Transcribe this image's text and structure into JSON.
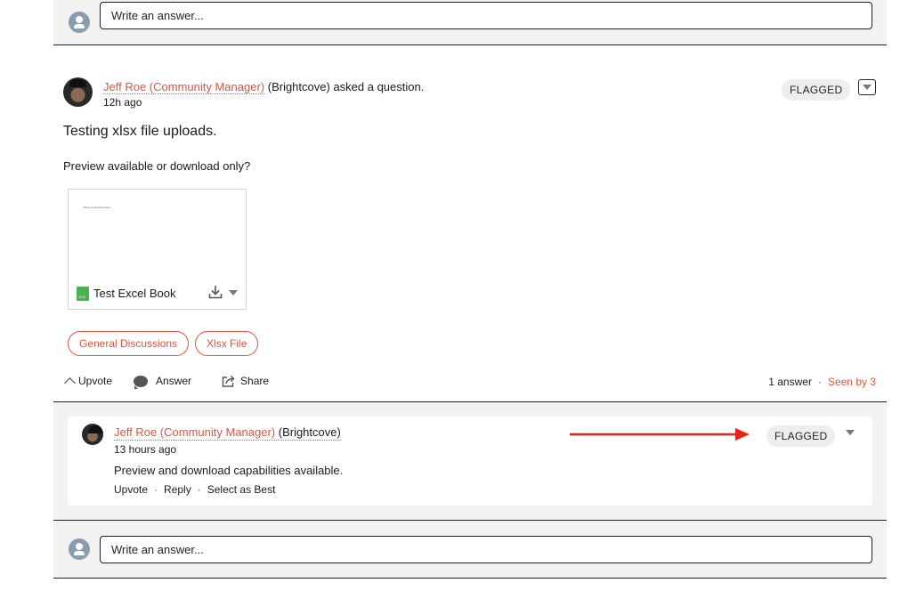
{
  "top_answer_bar": {
    "placeholder": "Write an answer..."
  },
  "question": {
    "author": "Jeff Roe (Community Manager)",
    "company": "(Brightcove)",
    "action_text": "asked a question.",
    "time": "12h ago",
    "flag": "FLAGGED",
    "title": "Testing xlsx file uploads.",
    "body": "Preview available or download only?",
    "attachment": {
      "preview_text": "This is a test document.",
      "file_type": "XLS",
      "file_name": "Test Excel Book"
    },
    "tags": [
      "General Discussions",
      "Xlsx File"
    ],
    "actions": {
      "upvote": "Upvote",
      "answer": "Answer",
      "share": "Share"
    },
    "stats": {
      "answers": "1 answer",
      "separator": "·",
      "seen": "Seen by 3"
    }
  },
  "answer": {
    "author": "Jeff Roe (Community Manager)",
    "company": "(Brightcove)",
    "time": "13 hours ago",
    "body": "Preview and download capabilities available.",
    "flag": "FLAGGED",
    "actions": [
      "Upvote",
      "Reply",
      "Select as Best"
    ],
    "separator": "·"
  },
  "bottom_answer_bar": {
    "placeholder": "Write an answer..."
  },
  "colors": {
    "accent": "#e8513a",
    "annotation_arrow": "#e8231a",
    "panel_bg": "#f2f2f2"
  }
}
